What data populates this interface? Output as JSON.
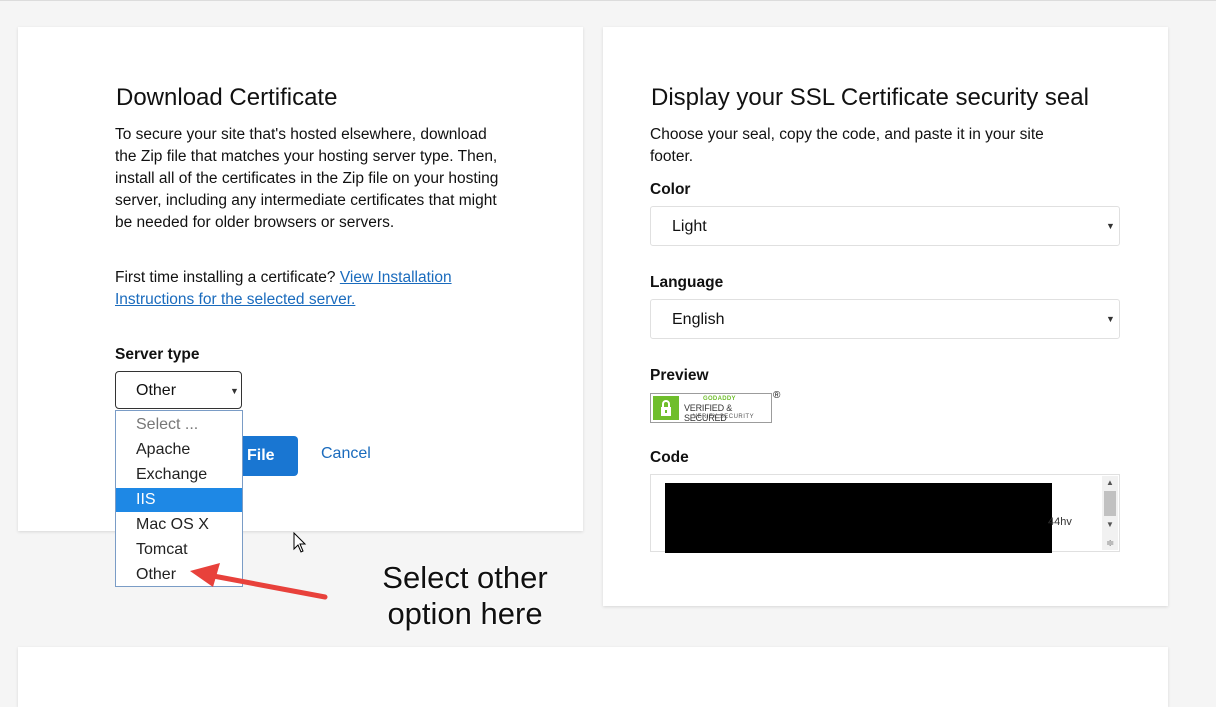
{
  "download": {
    "title": "Download Certificate",
    "description": "To secure your site that's hosted elsewhere, download the Zip file that matches your hosting server type. Then, install all of the certificates in the Zip file on your hosting server, including any intermediate certificates that might be needed for older browsers or servers.",
    "first_time_text": "First time installing a certificate?",
    "instructions_link": "View Installation Instructions for the selected server.",
    "server_type_label": "Server type",
    "server_type_value": "Other",
    "options": [
      "Select ...",
      "Apache",
      "Exchange",
      "IIS",
      "Mac OS X",
      "Tomcat",
      "Other"
    ],
    "highlighted_option": "IIS",
    "download_button": "File",
    "cancel": "Cancel"
  },
  "seal": {
    "title": "Display your SSL Certificate security seal",
    "description": "Choose your seal, copy the code, and paste it in your site footer.",
    "color_label": "Color",
    "color_value": "Light",
    "language_label": "Language",
    "language_value": "English",
    "preview_label": "Preview",
    "seal_brand": "GODADDY",
    "seal_verified": "VERIFIED & SECURED",
    "seal_sub": "VERIFY SECURITY",
    "seal_registered": "®",
    "code_label": "Code",
    "code_visible": "44hv"
  },
  "annotation": {
    "line1": "Select other",
    "line2": "option here"
  },
  "colors": {
    "accent": "#1976d2",
    "highlight": "#1e88e5",
    "link": "#1a6bbd",
    "seal_green": "#6fbe2c",
    "arrow": "#e8413b"
  }
}
